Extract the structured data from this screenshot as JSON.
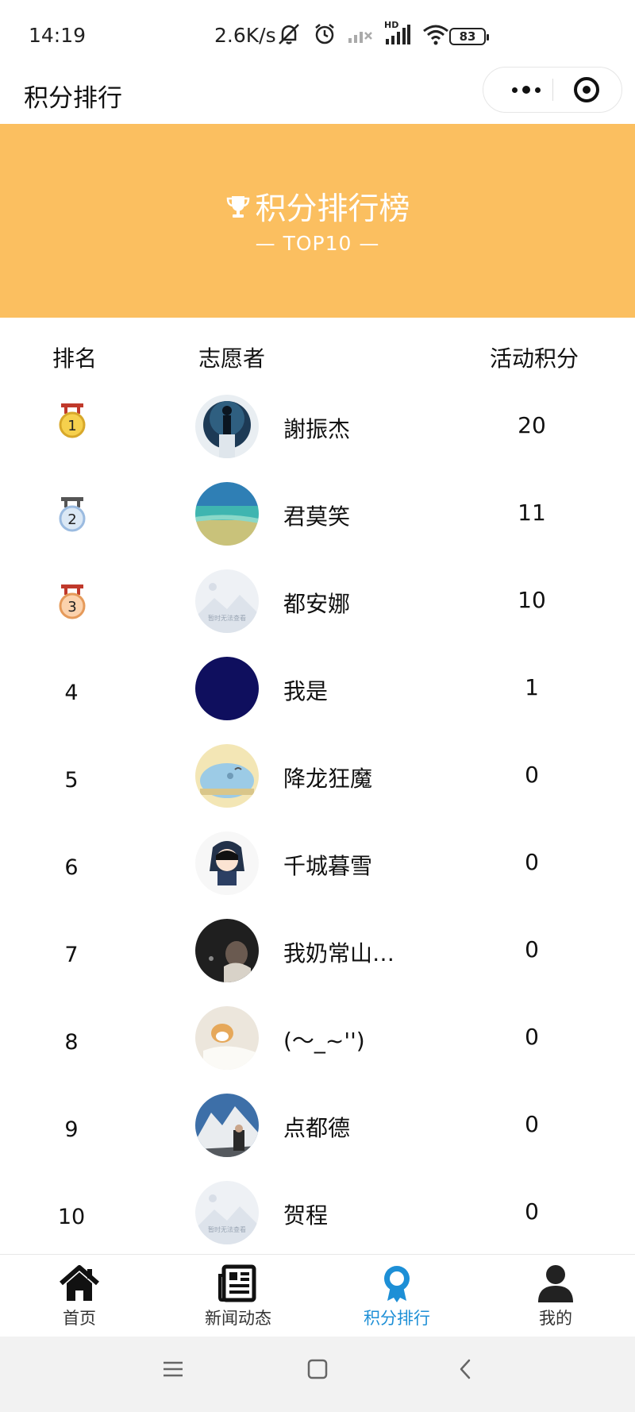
{
  "status_bar": {
    "time": "14:19",
    "speed": "2.6K/s",
    "battery": "83",
    "network_badge": "HD",
    "icons": [
      "mute-icon",
      "alarm-icon",
      "signal-icon",
      "signal-icon",
      "wifi-icon",
      "battery-icon"
    ]
  },
  "nav": {
    "title": "积分排行",
    "icons": [
      "more-icon",
      "target-icon"
    ]
  },
  "banner": {
    "title": "积分排行榜",
    "subtitle": "— TOP10 —",
    "icon": "trophy-icon",
    "color": "#fbbf60"
  },
  "table": {
    "headers": {
      "rank": "排名",
      "volunteer": "志愿者",
      "points": "活动积分"
    },
    "rows": [
      {
        "rank": "1",
        "medal": "gold-medal-icon",
        "name": "謝振杰",
        "points": "20",
        "avatar": "silhouette-photo"
      },
      {
        "rank": "2",
        "medal": "silver-medal-icon",
        "name": "君莫笑",
        "points": "11",
        "avatar": "beach-photo"
      },
      {
        "rank": "3",
        "medal": "bronze-medal-icon",
        "name": "都安娜",
        "points": "10",
        "avatar": "placeholder-image",
        "avatar_caption": "暂时无法查看"
      },
      {
        "rank": "4",
        "name": "我是",
        "points": "1",
        "avatar": "navy-solid"
      },
      {
        "rank": "5",
        "name": "降龙狂魔",
        "points": "0",
        "avatar": "cartoon-blob"
      },
      {
        "rank": "6",
        "name": "千城暮雪",
        "points": "0",
        "avatar": "anime-character"
      },
      {
        "rank": "7",
        "name": "我奶常山…",
        "points": "0",
        "avatar": "dark-portrait"
      },
      {
        "rank": "8",
        "name": "(〜_~'')",
        "points": "0",
        "avatar": "dog-photo"
      },
      {
        "rank": "9",
        "name": "点都德",
        "points": "0",
        "avatar": "snow-mountain-photo"
      },
      {
        "rank": "10",
        "name": "贺程",
        "points": "0",
        "avatar": "placeholder-image",
        "avatar_caption": "暂时无法查看"
      }
    ]
  },
  "tabbar": {
    "active_color": "#1d8fd6",
    "tabs": [
      {
        "label": "首页",
        "icon": "home-icon"
      },
      {
        "label": "新闻动态",
        "icon": "newspaper-icon"
      },
      {
        "label": "积分排行",
        "icon": "award-icon",
        "active": true
      },
      {
        "label": "我的",
        "icon": "user-icon"
      }
    ]
  },
  "system_nav": {
    "icons": [
      "menu-icon",
      "home-square-icon",
      "back-icon"
    ]
  }
}
